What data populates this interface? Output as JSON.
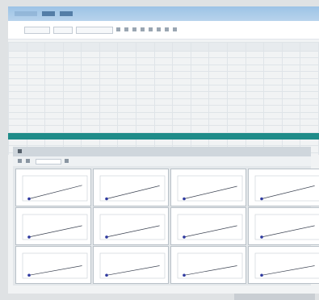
{
  "window": {
    "title": ""
  },
  "table": {
    "columns": [
      "",
      "",
      "",
      "",
      "",
      "",
      "",
      "",
      "",
      "",
      "",
      "",
      "",
      "",
      "",
      "",
      ""
    ],
    "row_count": 17,
    "highlight_row": 12,
    "colors": {
      "highlight": "#1f8c89",
      "header": "#e7ebee"
    }
  },
  "plots_window": {
    "title": ""
  },
  "chart_data": [
    {
      "type": "line",
      "title": "",
      "x_range": [
        0,
        1
      ],
      "y_range": [
        0,
        1
      ],
      "series": [
        {
          "x": [
            0.1,
            0.92
          ],
          "y": [
            0.08,
            0.62
          ]
        }
      ]
    },
    {
      "type": "line",
      "title": "",
      "x_range": [
        0,
        1
      ],
      "y_range": [
        0,
        1
      ],
      "series": [
        {
          "x": [
            0.1,
            0.92
          ],
          "y": [
            0.08,
            0.6
          ]
        }
      ]
    },
    {
      "type": "line",
      "title": "",
      "x_range": [
        0,
        1
      ],
      "y_range": [
        0,
        1
      ],
      "series": [
        {
          "x": [
            0.1,
            0.92
          ],
          "y": [
            0.08,
            0.58
          ]
        }
      ]
    },
    {
      "type": "line",
      "title": "",
      "x_range": [
        0,
        1
      ],
      "y_range": [
        0,
        1
      ],
      "series": [
        {
          "x": [
            0.1,
            0.92
          ],
          "y": [
            0.08,
            0.6
          ]
        }
      ]
    },
    {
      "type": "line",
      "title": "",
      "x_range": [
        0,
        1
      ],
      "y_range": [
        0,
        1
      ],
      "series": [
        {
          "x": [
            0.1,
            0.92
          ],
          "y": [
            0.1,
            0.55
          ]
        }
      ]
    },
    {
      "type": "line",
      "title": "",
      "x_range": [
        0,
        1
      ],
      "y_range": [
        0,
        1
      ],
      "series": [
        {
          "x": [
            0.1,
            0.92
          ],
          "y": [
            0.1,
            0.55
          ]
        }
      ]
    },
    {
      "type": "line",
      "title": "",
      "x_range": [
        0,
        1
      ],
      "y_range": [
        0,
        1
      ],
      "series": [
        {
          "x": [
            0.1,
            0.92
          ],
          "y": [
            0.1,
            0.55
          ]
        }
      ]
    },
    {
      "type": "line",
      "title": "",
      "x_range": [
        0,
        1
      ],
      "y_range": [
        0,
        1
      ],
      "series": [
        {
          "x": [
            0.1,
            0.92
          ],
          "y": [
            0.1,
            0.55
          ]
        }
      ]
    },
    {
      "type": "line",
      "title": "",
      "x_range": [
        0,
        1
      ],
      "y_range": [
        0,
        1
      ],
      "series": [
        {
          "x": [
            0.1,
            0.92
          ],
          "y": [
            0.12,
            0.5
          ]
        }
      ]
    },
    {
      "type": "line",
      "title": "",
      "x_range": [
        0,
        1
      ],
      "y_range": [
        0,
        1
      ],
      "series": [
        {
          "x": [
            0.1,
            0.92
          ],
          "y": [
            0.12,
            0.5
          ]
        }
      ]
    },
    {
      "type": "line",
      "title": "",
      "x_range": [
        0,
        1
      ],
      "y_range": [
        0,
        1
      ],
      "series": [
        {
          "x": [
            0.1,
            0.92
          ],
          "y": [
            0.12,
            0.5
          ]
        }
      ]
    },
    {
      "type": "line",
      "title": "",
      "x_range": [
        0,
        1
      ],
      "y_range": [
        0,
        1
      ],
      "series": [
        {
          "x": [
            0.1,
            0.92
          ],
          "y": [
            0.12,
            0.5
          ]
        }
      ]
    }
  ],
  "colors": {
    "series_line": "#3a4150",
    "series_dot": "#2f3aa0",
    "title_bar": "#9cc3e6"
  }
}
